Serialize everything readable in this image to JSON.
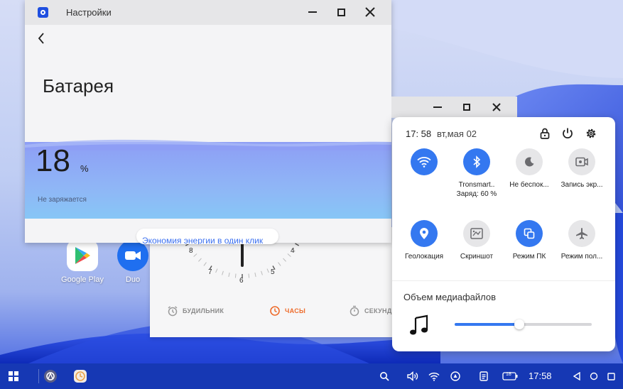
{
  "settings_window": {
    "title": "Настройки",
    "page_title": "Батарея",
    "battery_percent": "18",
    "battery_unit": "%",
    "battery_level": 0.18,
    "charge_status": "Не заряжается",
    "energy_saving_link": "Экономия энергии в один клик"
  },
  "clock_window": {
    "dial_numbers": [
      "8",
      "4",
      "7",
      "5",
      "6"
    ],
    "tabs": [
      {
        "label": "БУДИЛЬНИК",
        "active": false
      },
      {
        "label": "ЧАСЫ",
        "active": true
      },
      {
        "label": "СЕКУНД",
        "active": false
      }
    ]
  },
  "quick_settings": {
    "time": "17: 58",
    "date": "вт,мая 02",
    "tiles": [
      {
        "label": "",
        "sub": "",
        "icon": "wifi-icon",
        "on": true
      },
      {
        "label": "Tronsmart..",
        "sub": "Заряд: 60 %",
        "icon": "bluetooth-icon",
        "on": true
      },
      {
        "label": "Не беспок...",
        "sub": "",
        "icon": "moon-icon",
        "on": false
      },
      {
        "label": "Запись экр...",
        "sub": "",
        "icon": "screen-record-icon",
        "on": false
      },
      {
        "label": "Геолокация",
        "sub": "",
        "icon": "location-icon",
        "on": true
      },
      {
        "label": "Скриншот",
        "sub": "",
        "icon": "screenshot-icon",
        "on": false
      },
      {
        "label": "Режим ПК",
        "sub": "",
        "icon": "pc-mode-icon",
        "on": true
      },
      {
        "label": "Режим пол...",
        "sub": "",
        "icon": "airplane-icon",
        "on": false
      }
    ],
    "media_volume_label": "Объем медиафайлов",
    "media_volume_level": 0.47
  },
  "desktop_icons": [
    {
      "label": "Google Play",
      "icon": "google-play-icon"
    },
    {
      "label": "Duo",
      "icon": "duo-icon"
    }
  ],
  "taskbar": {
    "clock": "17:58",
    "battery_badge": "18"
  },
  "colors": {
    "accent": "#3478f0",
    "clock_active": "#ee6c2c",
    "taskbar": "#1638b4"
  }
}
